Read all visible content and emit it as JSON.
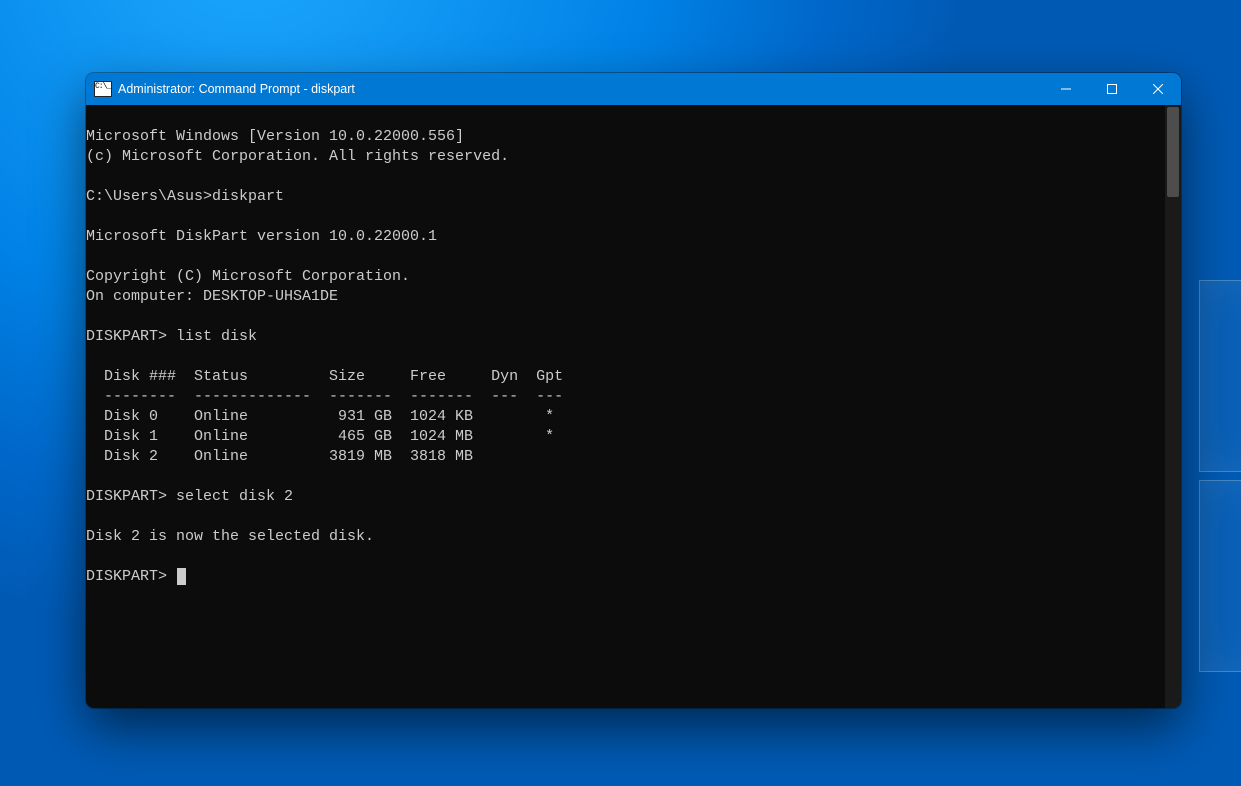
{
  "window": {
    "title": "Administrator: Command Prompt - diskpart"
  },
  "terminal": {
    "header_version": "Microsoft Windows [Version 10.0.22000.556]",
    "header_copyright": "(c) Microsoft Corporation. All rights reserved.",
    "prompt1": "C:\\Users\\Asus>diskpart",
    "diskpart_header": "Microsoft DiskPart version 10.0.22000.1",
    "diskpart_copyright": "Copyright (C) Microsoft Corporation.",
    "computer_line": "On computer: DESKTOP-UHSA1DE",
    "cmd_listdisk": "DISKPART> list disk",
    "table": {
      "header": "  Disk ###  Status         Size     Free     Dyn  Gpt",
      "divider": "  --------  -------------  -------  -------  ---  ---",
      "rows": [
        "  Disk 0    Online          931 GB  1024 KB        *",
        "  Disk 1    Online          465 GB  1024 MB        *",
        "  Disk 2    Online         3819 MB  3818 MB"
      ]
    },
    "cmd_select": "DISKPART> select disk 2",
    "select_result": "Disk 2 is now the selected disk.",
    "prompt_current": "DISKPART> "
  }
}
